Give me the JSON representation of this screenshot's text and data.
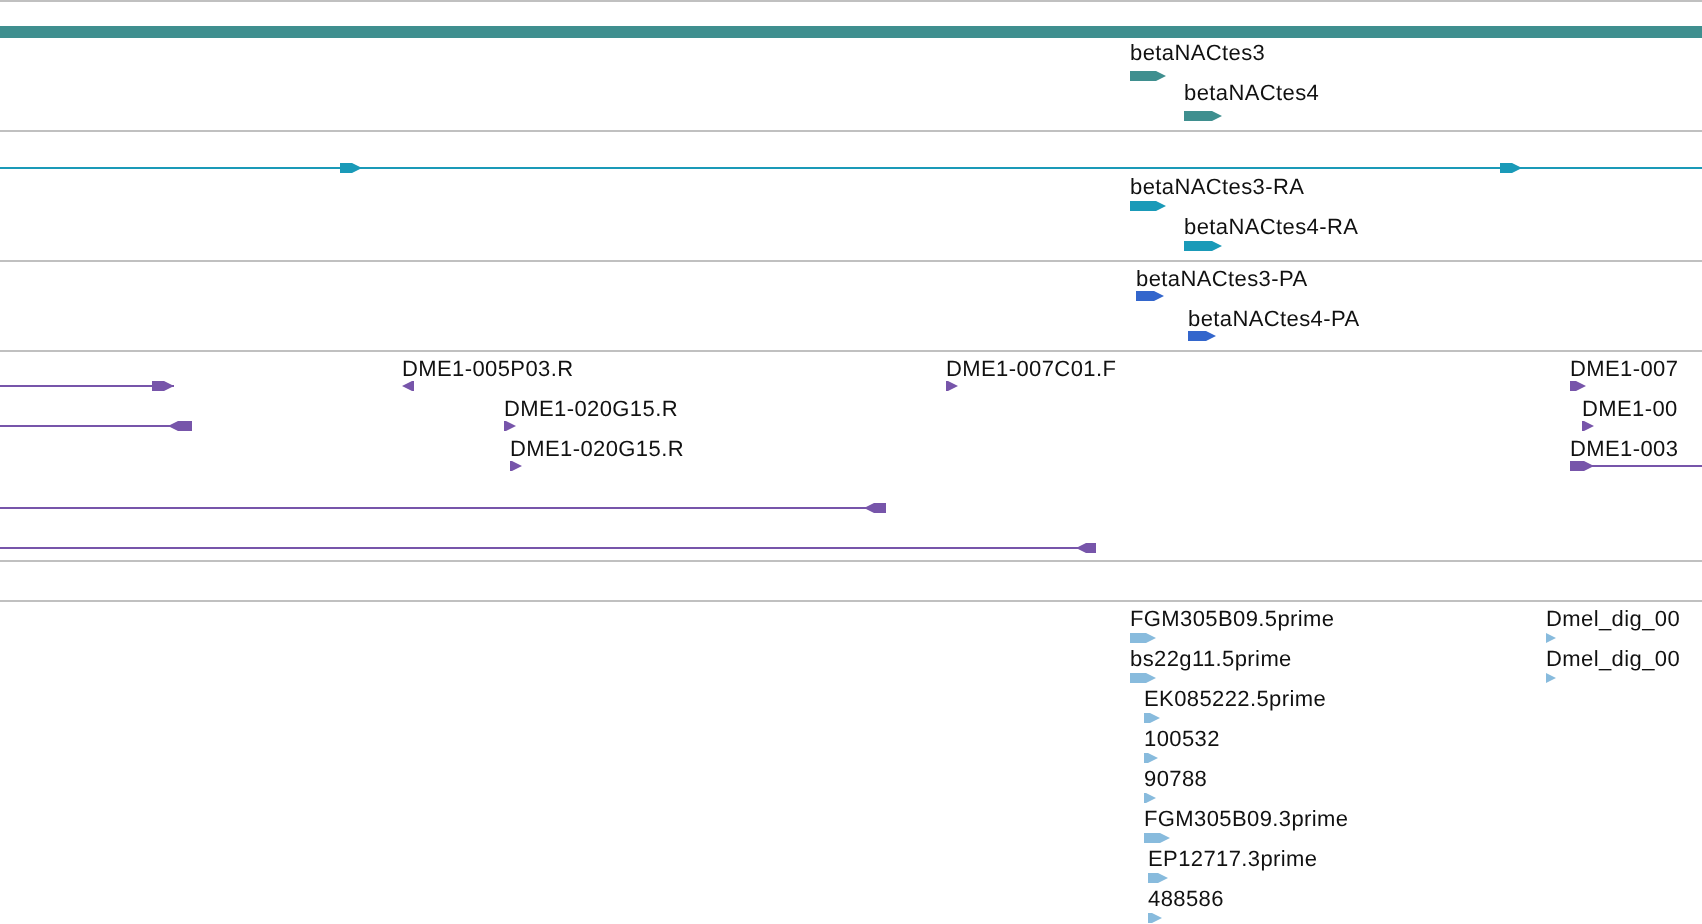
{
  "tracks": [
    {
      "color": "#3f8f8f",
      "features": [
        {
          "kind": "bar",
          "reverse": false
        },
        {
          "kind": "block",
          "reverse": false,
          "label": "betaNACtes3"
        },
        {
          "kind": "block",
          "reverse": false,
          "label": "betaNACtes4"
        }
      ]
    },
    {
      "color": "#1a9ab8",
      "features": [
        {
          "kind": "line",
          "reverse": false
        },
        {
          "kind": "block",
          "reverse": false,
          "label": "betaNACtes3-RA"
        },
        {
          "kind": "block",
          "reverse": false,
          "label": "betaNACtes4-RA"
        }
      ]
    },
    {
      "color": "#3366cc",
      "features": [
        {
          "kind": "block",
          "reverse": false,
          "label": "betaNACtes3-PA"
        },
        {
          "kind": "block",
          "reverse": false,
          "label": "betaNACtes4-PA"
        }
      ]
    },
    {
      "color": "#7755aa",
      "features": [
        {
          "kind": "line",
          "reverse": false
        },
        {
          "kind": "block",
          "reverse": true,
          "label": "DME1-005P03.R"
        },
        {
          "kind": "block",
          "reverse": false,
          "label": "DME1-007C01.F"
        },
        {
          "kind": "block",
          "reverse": false,
          "label": "DME1-007"
        },
        {
          "kind": "line",
          "reverse": true
        },
        {
          "kind": "block",
          "reverse": false,
          "label": "DME1-020G15.R"
        },
        {
          "kind": "block",
          "reverse": false,
          "label": "DME1-00"
        },
        {
          "kind": "block",
          "reverse": false,
          "label": "DME1-020G15.R"
        },
        {
          "kind": "line",
          "reverse": false,
          "label": "DME1-003"
        },
        {
          "kind": "line",
          "reverse": true
        },
        {
          "kind": "line",
          "reverse": true
        }
      ]
    },
    {
      "color": "#88bbdd",
      "features": [
        {
          "kind": "block",
          "reverse": false,
          "label": "FGM305B09.5prime"
        },
        {
          "kind": "block",
          "reverse": false,
          "label": "Dmel_dig_00"
        },
        {
          "kind": "block",
          "reverse": false,
          "label": "bs22g11.5prime"
        },
        {
          "kind": "block",
          "reverse": false,
          "label": "Dmel_dig_00"
        },
        {
          "kind": "block",
          "reverse": false,
          "label": "EK085222.5prime"
        },
        {
          "kind": "block",
          "reverse": false,
          "label": "100532"
        },
        {
          "kind": "block",
          "reverse": false,
          "label": "90788"
        },
        {
          "kind": "block",
          "reverse": false,
          "label": "FGM305B09.3prime"
        },
        {
          "kind": "block",
          "reverse": false,
          "label": "EP12717.3prime"
        },
        {
          "kind": "block",
          "reverse": false,
          "label": "488586"
        }
      ]
    }
  ]
}
